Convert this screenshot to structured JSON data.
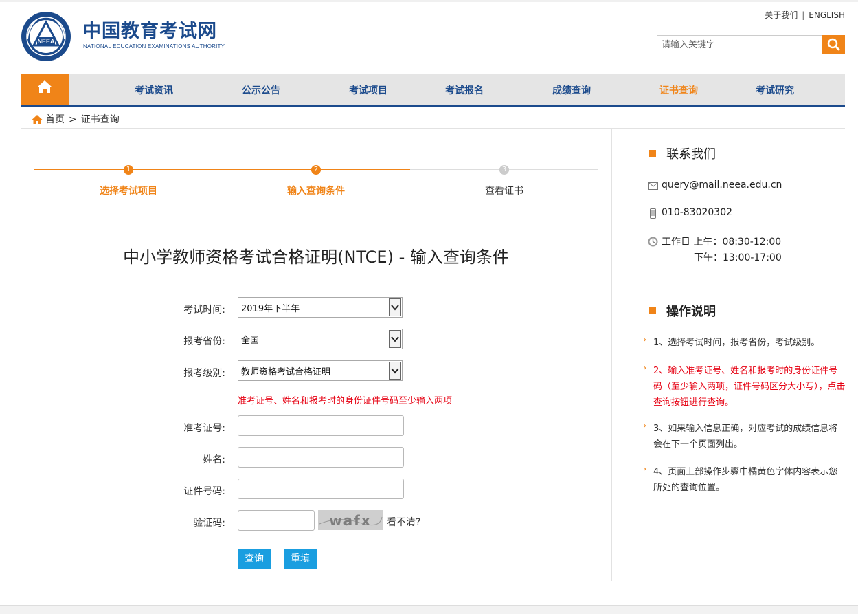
{
  "header": {
    "title": "中国教育考试网",
    "subtitle": "NATIONAL EDUCATION EXAMINATIONS AUTHORITY",
    "logo_text": "NEEA",
    "links": [
      "关于我们",
      "ENGLISH"
    ],
    "search_placeholder": "请输入关键字"
  },
  "nav": {
    "items": [
      "考试资讯",
      "公示公告",
      "考试项目",
      "考试报名",
      "成绩查询",
      "证书查询",
      "考试研究"
    ],
    "active": "证书查询"
  },
  "breadcrumb": [
    "首页",
    "证书查询"
  ],
  "steps": [
    {
      "num": "1",
      "label": "选择考试项目",
      "state": "done"
    },
    {
      "num": "2",
      "label": "输入查询条件",
      "state": "current"
    },
    {
      "num": "3",
      "label": "查看证书",
      "state": "pending"
    }
  ],
  "form": {
    "title": "中小学教师资格考试合格证明(NTCE) - 输入查询条件",
    "exam_time": {
      "label": "考试时间:",
      "value": "2019年下半年"
    },
    "province": {
      "label": "报考省份:",
      "value": "全国"
    },
    "level": {
      "label": "报考级别:",
      "value": "教师资格考试合格证明"
    },
    "warning": "准考证号、姓名和报考时的身份证件号码至少输入两项",
    "ticket": {
      "label": "准考证号:"
    },
    "name": {
      "label": "姓名:"
    },
    "id_number": {
      "label": "证件号码:"
    },
    "captcha": {
      "label": "验证码:",
      "image_text": "wafx",
      "refresh": "看不清?"
    },
    "submit": "查询",
    "reset": "重填"
  },
  "sidebar": {
    "contact_title": "联系我们",
    "email": "query@mail.neea.edu.cn",
    "phone": "010-83020302",
    "hours_am": "工作日 上午：08:30-12:00",
    "hours_pm": "下午：13:00-17:00",
    "ops_title": "操作说明",
    "ops": [
      "1、选择考试时间，报考省份，考试级别。",
      "2、输入准考证号、姓名和报考时的身份证件号码（至少输入两项，证件号码区分大小写），点击查询按钮进行查询。",
      "3、如果输入信息正确，对应考试的成绩信息将会在下一个页面列出。",
      "4、页面上部操作步骤中橘黄色字体内容表示您所处的查询位置。"
    ]
  },
  "colors": {
    "orange": "#f08418",
    "navy": "#1b4a8c",
    "red": "#e60012",
    "button_blue": "#1a9ee0"
  }
}
